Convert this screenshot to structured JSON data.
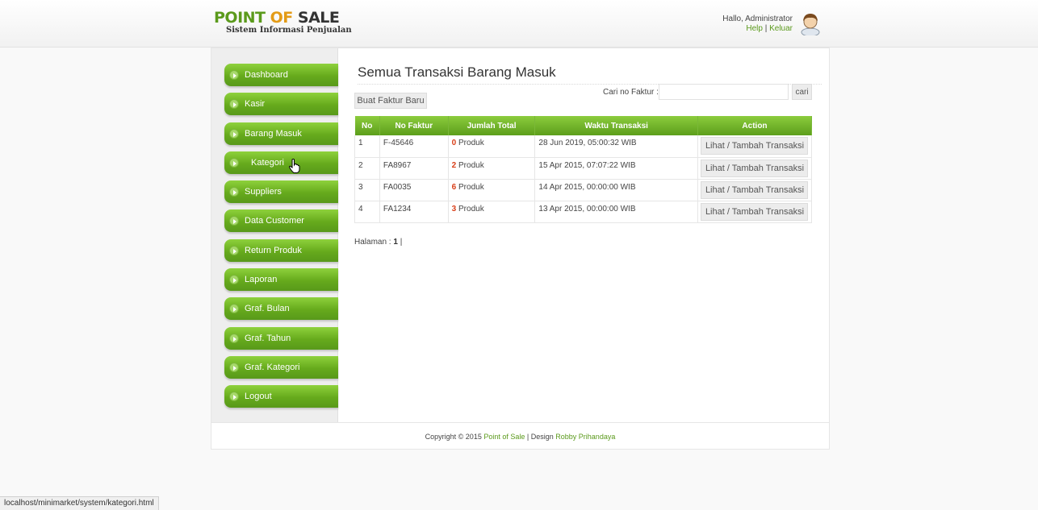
{
  "header": {
    "logo_word1": "POINT",
    "logo_word2": "OF",
    "logo_word3": "SALE",
    "logo_subtitle": "Sistem Informasi Penjualan",
    "greeting": "Hallo, Administrator",
    "help_link": "Help",
    "separator": "|",
    "logout_link": "Keluar"
  },
  "sidebar": {
    "items": [
      {
        "label": "Dashboard"
      },
      {
        "label": "Kasir"
      },
      {
        "label": "Barang Masuk"
      },
      {
        "label": "Kategori"
      },
      {
        "label": "Suppliers"
      },
      {
        "label": "Data Customer"
      },
      {
        "label": "Return Produk"
      },
      {
        "label": "Laporan"
      },
      {
        "label": "Graf. Bulan"
      },
      {
        "label": "Graf. Tahun"
      },
      {
        "label": "Graf. Kategori"
      },
      {
        "label": "Logout"
      }
    ]
  },
  "main": {
    "title": "Semua Transaksi Barang Masuk",
    "search_label": "Cari no Faktur :",
    "search_value": "",
    "search_button": "cari",
    "new_button": "Buat Faktur Baru",
    "table": {
      "headers": [
        "No",
        "No Faktur",
        "Jumlah Total",
        "Waktu Transaksi",
        "Action"
      ],
      "rows": [
        {
          "no": "1",
          "faktur": "F-45646",
          "qty": "0",
          "unit": "Produk",
          "time": "28 Jun 2019, 05:00:32 WIB",
          "action": "Lihat / Tambah Transaksi"
        },
        {
          "no": "2",
          "faktur": "FA8967",
          "qty": "2",
          "unit": "Produk",
          "time": "15 Apr 2015, 07:07:22 WIB",
          "action": "Lihat / Tambah Transaksi"
        },
        {
          "no": "3",
          "faktur": "FA0035",
          "qty": "6",
          "unit": "Produk",
          "time": "14 Apr 2015, 00:00:00 WIB",
          "action": "Lihat / Tambah Transaksi"
        },
        {
          "no": "4",
          "faktur": "FA1234",
          "qty": "3",
          "unit": "Produk",
          "time": "13 Apr 2015, 00:00:00 WIB",
          "action": "Lihat / Tambah Transaksi"
        }
      ]
    },
    "pagination_label": "Halaman :",
    "pagination_current": "1",
    "pagination_sep": "|"
  },
  "footer": {
    "copyright": "Copyright © 2015",
    "app_name": "Point of Sale",
    "design_label": "| Design",
    "designer": "Robby Prihandaya"
  },
  "statusbar": {
    "url": "localhost/minimarket/system/kategori.html"
  },
  "colors": {
    "brand_green": "#5b9a1c",
    "brand_orange": "#e39b16",
    "qty_red": "#d9401a"
  },
  "icons": {
    "menu_bullet": "arrow-circle-icon",
    "user_avatar": "user-avatar-icon",
    "mouse_cursor": "hand-cursor-icon"
  }
}
